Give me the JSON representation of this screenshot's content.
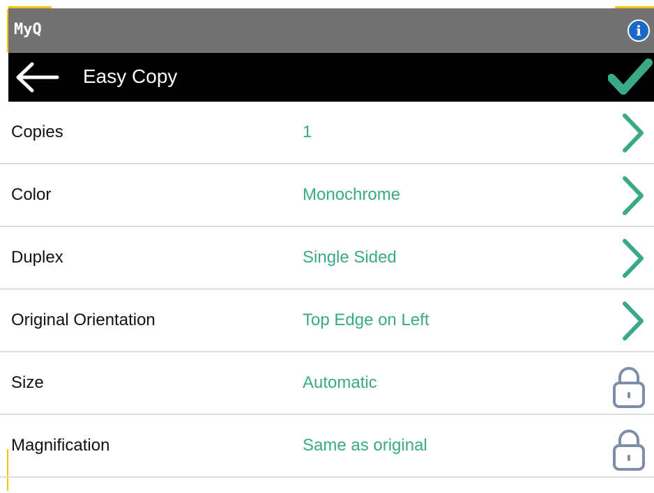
{
  "header": {
    "app_name": "MyQ",
    "info_icon": "info-icon",
    "info_glyph": "i"
  },
  "title_bar": {
    "title": "Easy Copy",
    "back_icon": "back-arrow-icon",
    "confirm_icon": "checkmark-icon"
  },
  "colors": {
    "app_bar": "#727272",
    "title_bar": "#000000",
    "accent": "#3aa98a",
    "lock": "#7d8fa8",
    "info": "#1a68c8",
    "highlight": "#f2c500"
  },
  "settings": [
    {
      "label": "Copies",
      "value": "1",
      "icon": "chevron-right-icon"
    },
    {
      "label": "Color",
      "value": "Monochrome",
      "icon": "chevron-right-icon"
    },
    {
      "label": "Duplex",
      "value": "Single Sided",
      "icon": "chevron-right-icon"
    },
    {
      "label": "Original Orientation",
      "value": "Top Edge on Left",
      "icon": "chevron-right-icon"
    },
    {
      "label": "Size",
      "value": "Automatic",
      "icon": "lock-icon"
    },
    {
      "label": "Magnification",
      "value": "Same as original",
      "icon": "lock-icon"
    }
  ]
}
